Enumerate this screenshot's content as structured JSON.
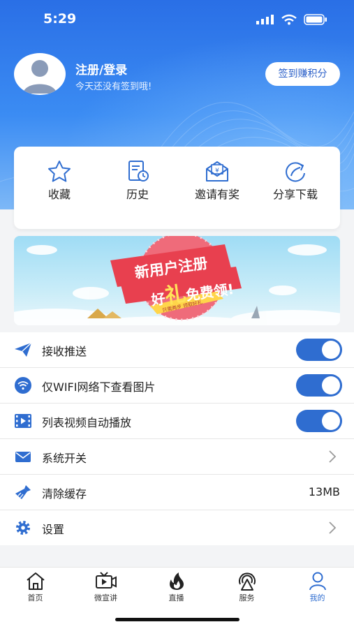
{
  "status": {
    "time": "5:29"
  },
  "profile": {
    "name": "注册/登录",
    "subtitle": "今天还没有签到哦!",
    "checkin_label": "签到赚积分"
  },
  "quick_actions": [
    {
      "label": "收藏",
      "icon": "star-icon"
    },
    {
      "label": "历史",
      "icon": "history-icon"
    },
    {
      "label": "邀请有奖",
      "icon": "invite-icon"
    },
    {
      "label": "分享下载",
      "icon": "share-icon"
    }
  ],
  "banner": {
    "line1": "新用户注册",
    "line2_a": "好",
    "line2_b": "礼",
    "line2_c": "免费领!",
    "tag": "只需两步 领取好礼"
  },
  "settings": {
    "push": {
      "label": "接收推送",
      "enabled": true
    },
    "wifi_images": {
      "label": "仅WIFI网络下查看图片",
      "enabled": true
    },
    "autoplay": {
      "label": "列表视频自动播放",
      "enabled": true
    },
    "system_switch": {
      "label": "系统开关"
    },
    "clear_cache": {
      "label": "清除缓存",
      "value": "13MB"
    },
    "settings": {
      "label": "设置"
    }
  },
  "tabs": [
    {
      "label": "首页",
      "icon": "home-icon",
      "active": false
    },
    {
      "label": "微宣讲",
      "icon": "video-icon",
      "active": false
    },
    {
      "label": "直播",
      "icon": "fire-icon",
      "active": false
    },
    {
      "label": "服务",
      "icon": "service-icon",
      "active": false
    },
    {
      "label": "我的",
      "icon": "user-icon",
      "active": true
    }
  ],
  "colors": {
    "accent": "#2f6dd0",
    "header_top": "#2a6fe6",
    "header_bottom": "#7db8f7",
    "banner_red": "#e8404f"
  }
}
